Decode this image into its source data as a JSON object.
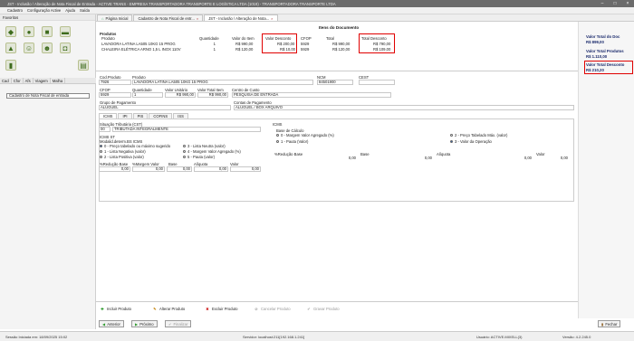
{
  "window": {
    "title": "JST - Inclusão / Alteração de Nota Fiscal de Entrada - ACTIVE TRANS - EMPRESA TRANSPORTADORA TRANSPORTE E LOGÍSTICA LTDA (1019) - TRANSPORTADORA TRANSPORTE LTDA"
  },
  "menu": [
    "Cadastro",
    "Configuração Active",
    "Ajuda",
    "Saída"
  ],
  "left": {
    "favorites": "Favoritos",
    "tabs": [
      "Cad",
      "Cfor",
      "Afs",
      "Viagem",
      "Malha"
    ],
    "tree_item": "Cadastro de Nota Fiscal de entrada"
  },
  "tabs": [
    "Página Inicial",
    "Cadastro de Nota Fiscal de entr...",
    "JST - Inclusão / Alteração de Nota..."
  ],
  "doc": {
    "title": "Itens do Documento",
    "section": "Produtos"
  },
  "grid": {
    "headers": [
      "Produto",
      "Quantidade",
      "Valor do Item",
      "Valor Desconto",
      "CFOP",
      "Total",
      "Total Desconto"
    ],
    "rows": [
      [
        "LAVADORA LATINA LA505 10KG 15 PROG",
        "1",
        "R$ 990,00",
        "R$ 200,00",
        "5929",
        "R$ 990,00",
        "R$ 790,00"
      ],
      [
        "CHALEIRA ELÉTRICA ARNO 1,5 L INOX 110V",
        "1",
        "R$ 120,00",
        "R$ 10,00",
        "5929",
        "R$ 120,00",
        "R$ 109,00"
      ]
    ]
  },
  "totals": {
    "label1": "Valor Total do Doc",
    "val1": "R$ 899,00",
    "label2": "Valor Total Produtos",
    "val2": "R$ 1.110,00",
    "label3": "Valor Total Desconto",
    "val3": "R$ 210,20"
  },
  "form": {
    "cod_produto_label": "Cod.Produto",
    "cod_produto": "7926",
    "produto_label": "Produto",
    "produto": "LAVADORA LATINA LA505 10KG 15 PROG",
    "ncm_label": "NCM",
    "ncm": "84501900",
    "cest_label": "CEST",
    "cest": "",
    "cfop_label": "CFOP",
    "cfop": "5929",
    "quantidade_label": "Quantidade",
    "quantidade": "1",
    "valor_unitario_label": "Valor Unitário",
    "valor_unitario": "R$ 990,00",
    "valor_total_item_label": "Valor Total Item",
    "valor_total_item": "R$ 990,00",
    "centro_custo_label": "Centro de Custo",
    "centro_custo": "PESQUISA DE ENTRADA",
    "grupo_pag_label": "Grupo de Pagamento",
    "grupo_pag": "ALUGUEL",
    "conta_pag_label": "Contas de Pagamento",
    "conta_pag": "ALUGUEL / BOX ARQUIVO",
    "subtabs": [
      "ICMS",
      "IPI",
      "PIS",
      "COFINS",
      "ISS"
    ],
    "sit_trib_label": "Situação Tributária (CST)",
    "sit_trib_code": "00",
    "sit_trib": "TRIBUTADA INTEGRALMENTE",
    "icms_st": "ICMS ST",
    "mod_label": "Modalid.determ.BS ICMS",
    "mod_options": [
      "0 - Preço tabelado ou máximo sugerido",
      "1 - Lista Negativa (valor)",
      "2 - Lista Positiva (valor)",
      "3 - Lista Neutra (valor)",
      "4 - Margem Valor Agregado (%)",
      "5 - Pauta (valor)"
    ],
    "st_cols": [
      "%Redução Base",
      "%Margem Valor",
      "Base",
      "Alíquota",
      "Valor"
    ],
    "st_vals": [
      "0,00",
      "0,00",
      "0,00",
      "0,00",
      "0,00"
    ],
    "icms_label": "ICMS",
    "base_calc_label": "Base de Cálculo",
    "bc_options": [
      "0 - Margem Valor Agregado (%)",
      "1 - Pauta (Valor)",
      "2 - Preço Tabelado Máx. (valor)",
      "3 - Valor da Operação"
    ],
    "icms_cols": [
      "%Redução Base",
      "Base",
      "Alíquota",
      "Valor"
    ],
    "icms_vals": [
      "0,00",
      "0,00",
      "0,00",
      "0,00"
    ]
  },
  "actions": {
    "incluir": "Incluir Produto",
    "alterar": "Alterar Produto",
    "excluir": "Excluir Produto",
    "cancelar": "Cancelar Produto",
    "gravar": "Gravar Produto",
    "anterior": "Anterior",
    "proximo": "Próximo",
    "finalizar": "Finalizar",
    "fechar": "Fechar"
  },
  "status": {
    "sessao": "Sessão Iniciada em: 18/09/2025 15:02",
    "servidor": "Servidor: localhost:211[192.168.1.241]",
    "usuario": "Usuário: ACTIVE.MIXELL(3)",
    "versao": "Versão: 4.2.245.0"
  }
}
